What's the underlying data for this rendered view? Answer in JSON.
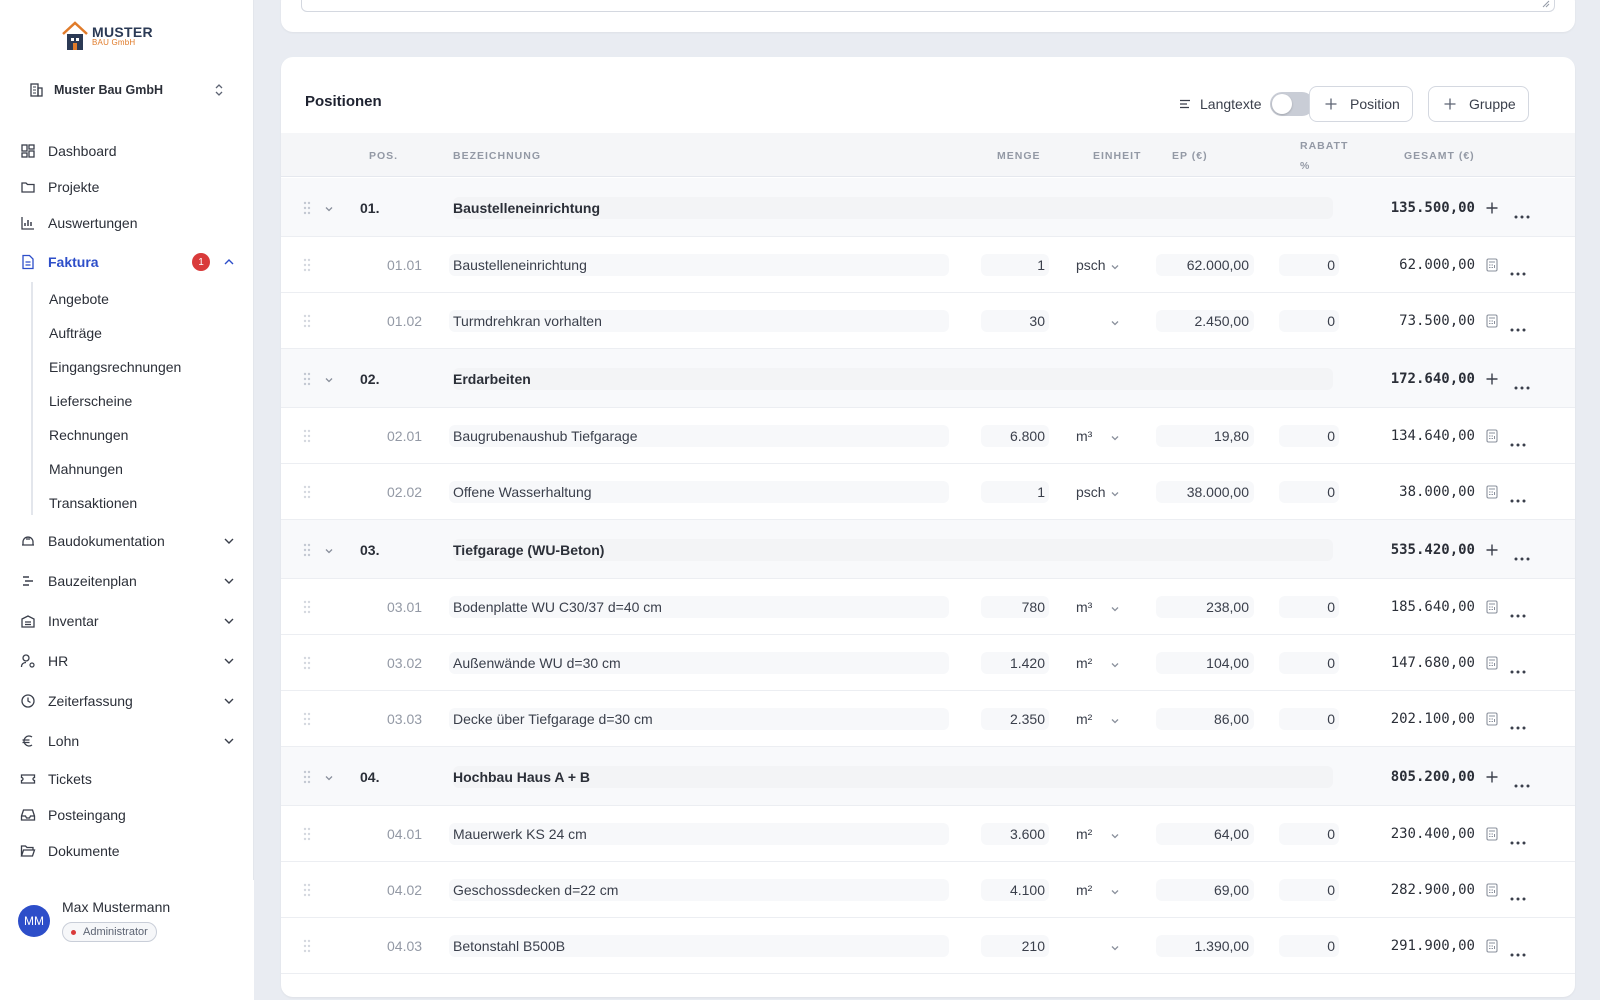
{
  "brand": {
    "name": "MUSTER",
    "sub": "BAU GmbH"
  },
  "company": {
    "name": "Muster Bau GmbH"
  },
  "nav": {
    "dashboard": "Dashboard",
    "projekte": "Projekte",
    "auswertungen": "Auswertungen",
    "faktura": "Faktura",
    "faktura_badge": "1",
    "sub": [
      "Angebote",
      "Aufträge",
      "Eingangsrechnungen",
      "Lieferscheine",
      "Rechnungen",
      "Mahnungen",
      "Transaktionen"
    ],
    "baudokumentation": "Baudokumentation",
    "bauzeitenplan": "Bauzeitenplan",
    "inventar": "Inventar",
    "hr": "HR",
    "zeiterfassung": "Zeiterfassung",
    "lohn": "Lohn",
    "tickets": "Tickets",
    "posteingang": "Posteingang",
    "dokumente": "Dokumente"
  },
  "user": {
    "initials": "MM",
    "name": "Max Mustermann",
    "role": "Administrator"
  },
  "positions": {
    "title": "Positionen",
    "langtexte_label": "Langtexte",
    "langtexte_on": false,
    "add_position": "Position",
    "add_group": "Gruppe",
    "columns": {
      "pos": "POS.",
      "bezeichnung": "BEZEICHNUNG",
      "menge": "MENGE",
      "einheit": "EINHEIT",
      "ep": "EP (€)",
      "rabatt_1": "RABATT",
      "rabatt_2": "%",
      "gesamt": "GESAMT (€)"
    },
    "groups": [
      {
        "pos": "01.",
        "name": "Baustelleneinrichtung",
        "total": "135.500,00",
        "items": [
          {
            "pos": "01.01",
            "name": "Baustelleneinrichtung",
            "menge": "1",
            "unit": "psch",
            "ep": "62.000,00",
            "rabatt": "0",
            "total": "62.000,00"
          },
          {
            "pos": "01.02",
            "name": "Turmdrehkran vorhalten",
            "menge": "30",
            "unit": "",
            "ep": "2.450,00",
            "rabatt": "0",
            "total": "73.500,00"
          }
        ]
      },
      {
        "pos": "02.",
        "name": "Erdarbeiten",
        "total": "172.640,00",
        "items": [
          {
            "pos": "02.01",
            "name": "Baugrubenaushub Tiefgarage",
            "menge": "6.800",
            "unit": "m³",
            "ep": "19,80",
            "rabatt": "0",
            "total": "134.640,00"
          },
          {
            "pos": "02.02",
            "name": "Offene Wasserhaltung",
            "menge": "1",
            "unit": "psch",
            "ep": "38.000,00",
            "rabatt": "0",
            "total": "38.000,00"
          }
        ]
      },
      {
        "pos": "03.",
        "name": "Tiefgarage (WU-Beton)",
        "total": "535.420,00",
        "items": [
          {
            "pos": "03.01",
            "name": "Bodenplatte WU C30/37 d=40 cm",
            "menge": "780",
            "unit": "m³",
            "ep": "238,00",
            "rabatt": "0",
            "total": "185.640,00"
          },
          {
            "pos": "03.02",
            "name": "Außenwände WU d=30 cm",
            "menge": "1.420",
            "unit": "m²",
            "ep": "104,00",
            "rabatt": "0",
            "total": "147.680,00"
          },
          {
            "pos": "03.03",
            "name": "Decke über Tiefgarage d=30 cm",
            "menge": "2.350",
            "unit": "m²",
            "ep": "86,00",
            "rabatt": "0",
            "total": "202.100,00"
          }
        ]
      },
      {
        "pos": "04.",
        "name": "Hochbau Haus A + B",
        "total": "805.200,00",
        "items": [
          {
            "pos": "04.01",
            "name": "Mauerwerk KS 24 cm",
            "menge": "3.600",
            "unit": "m²",
            "ep": "64,00",
            "rabatt": "0",
            "total": "230.400,00"
          },
          {
            "pos": "04.02",
            "name": "Geschossdecken d=22 cm",
            "menge": "4.100",
            "unit": "m²",
            "ep": "69,00",
            "rabatt": "0",
            "total": "282.900,00"
          },
          {
            "pos": "04.03",
            "name": "Betonstahl B500B",
            "menge": "210",
            "unit": "",
            "ep": "1.390,00",
            "rabatt": "0",
            "total": "291.900,00"
          }
        ]
      }
    ]
  },
  "colors": {
    "accent": "#2d4ec9",
    "badge": "#d93a3a",
    "brand_orange": "#e07b2a",
    "brand_navy": "#2b3a55"
  }
}
